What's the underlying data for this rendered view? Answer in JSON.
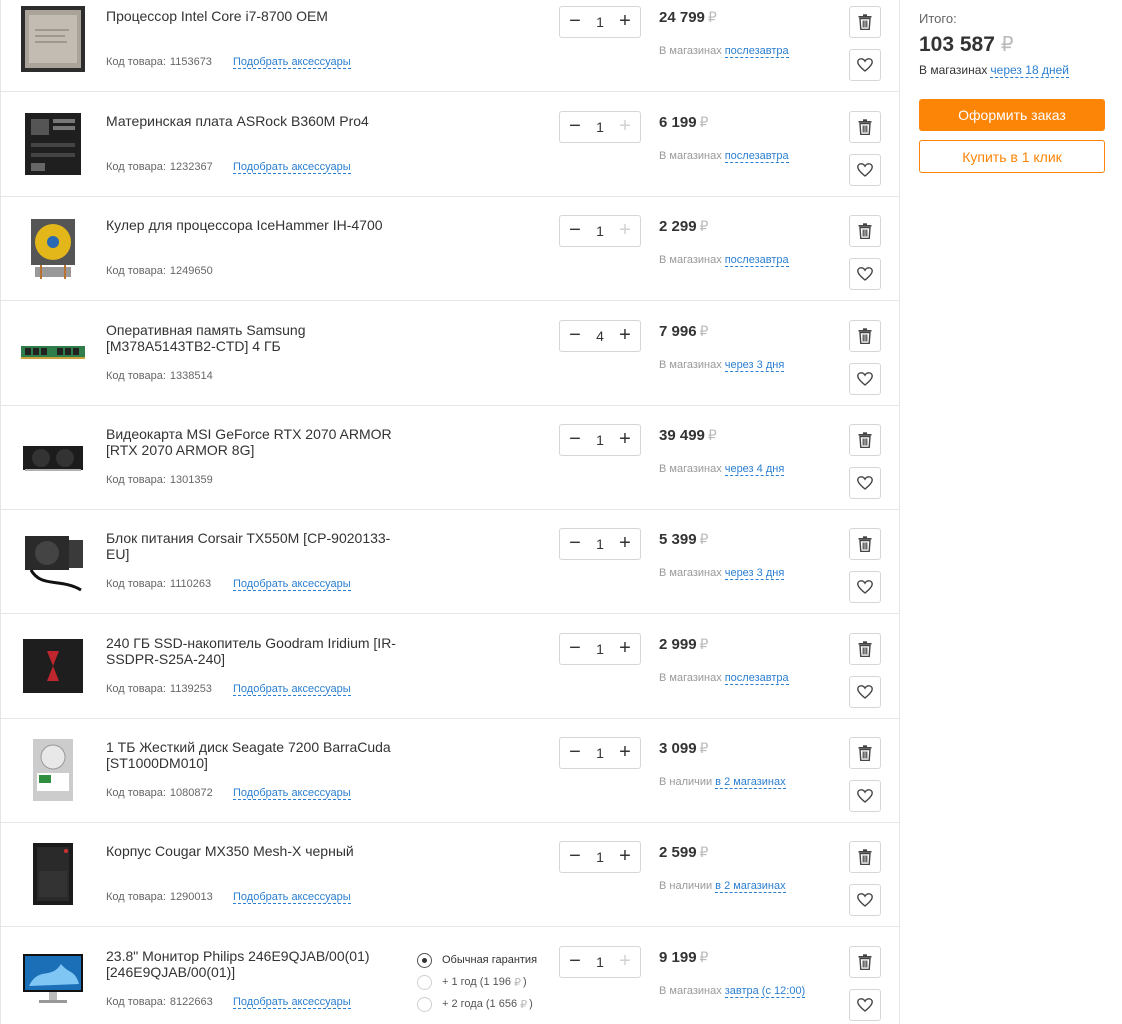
{
  "currency": "₽",
  "code_prefix": "Код товара:",
  "accessories_label": "Подобрать аксессуары",
  "items": [
    {
      "name": "Процессор Intel Core i7-8700 OEM",
      "code": "1153673",
      "qty": "1",
      "price": "24 799",
      "avail_prefix": "В магазинах",
      "avail_link": "послезавтра",
      "has_acc": true,
      "plus_disabled": false,
      "minus_disabled": false,
      "image": "cpu-chip-image"
    },
    {
      "name": "Материнская плата ASRock B360M Pro4",
      "code": "1232367",
      "qty": "1",
      "price": "6 199",
      "avail_prefix": "В магазинах",
      "avail_link": "послезавтра",
      "has_acc": true,
      "plus_disabled": true,
      "minus_disabled": false,
      "image": "motherboard-image"
    },
    {
      "name": "Кулер для процессора IceHammer IH-4700",
      "code": "1249650",
      "qty": "1",
      "price": "2 299",
      "avail_prefix": "В магазинах",
      "avail_link": "послезавтра",
      "has_acc": false,
      "plus_disabled": true,
      "minus_disabled": false,
      "image": "cooler-image"
    },
    {
      "name": "Оперативная память Samsung [M378A5143TB2-CTD] 4 ГБ",
      "code": "1338514",
      "qty": "4",
      "price": "7 996",
      "avail_prefix": "В магазинах",
      "avail_link": "через 3 дня",
      "has_acc": false,
      "plus_disabled": false,
      "minus_disabled": false,
      "image": "ram-image"
    },
    {
      "name": "Видеокарта MSI GeForce RTX 2070 ARMOR [RTX 2070 ARMOR 8G]",
      "code": "1301359",
      "qty": "1",
      "price": "39 499",
      "avail_prefix": "В магазинах",
      "avail_link": "через 4 дня",
      "has_acc": false,
      "plus_disabled": false,
      "minus_disabled": false,
      "image": "gpu-image"
    },
    {
      "name": "Блок питания Corsair TX550M [CP-9020133-EU]",
      "code": "1110263",
      "qty": "1",
      "price": "5 399",
      "avail_prefix": "В магазинах",
      "avail_link": "через 3 дня",
      "has_acc": true,
      "plus_disabled": false,
      "minus_disabled": false,
      "image": "psu-image"
    },
    {
      "name": "240 ГБ SSD-накопитель Goodram Iridium [IR-SSDPR-S25A-240]",
      "code": "1139253",
      "qty": "1",
      "price": "2 999",
      "avail_prefix": "В магазинах",
      "avail_link": "послезавтра",
      "has_acc": true,
      "plus_disabled": false,
      "minus_disabled": false,
      "image": "ssd-image"
    },
    {
      "name": "1 ТБ Жесткий диск Seagate 7200 BarraCuda [ST1000DM010]",
      "code": "1080872",
      "qty": "1",
      "price": "3 099",
      "avail_prefix": "В наличии",
      "avail_link": "в 2 магазинах",
      "has_acc": true,
      "plus_disabled": false,
      "minus_disabled": false,
      "image": "hdd-image"
    },
    {
      "name": "Корпус Cougar MX350 Mesh-X черный",
      "code": "1290013",
      "qty": "1",
      "price": "2 599",
      "avail_prefix": "В наличии",
      "avail_link": "в 2 магазинах",
      "has_acc": true,
      "plus_disabled": false,
      "minus_disabled": false,
      "image": "case-image"
    },
    {
      "name": "23.8\" Монитор Philips 246E9QJAB/00(01) [246E9QJAB/00(01)]",
      "code": "8122663",
      "qty": "1",
      "price": "9 199",
      "avail_prefix": "В магазинах",
      "avail_link": "завтра (с 12:00)",
      "has_acc": true,
      "plus_disabled": true,
      "minus_disabled": false,
      "image": "monitor-image"
    }
  ],
  "warranty": {
    "options": [
      {
        "label": "Обычная гарантия",
        "price": "",
        "checked": true
      },
      {
        "label": "+ 1 год (1 196",
        "price": ")",
        "checked": false
      },
      {
        "label": "+ 2 года (1 656",
        "price": ")",
        "checked": false
      }
    ]
  },
  "summary": {
    "label": "Итого:",
    "total": "103 587",
    "avail_prefix": "В магазинах",
    "avail_link": "через 18 дней",
    "order_button": "Оформить заказ",
    "one_click_button": "Купить в 1 клик"
  },
  "colors": {
    "accent": "#fc8507",
    "link": "#2b7fd0",
    "border": "#e6e6e6"
  }
}
